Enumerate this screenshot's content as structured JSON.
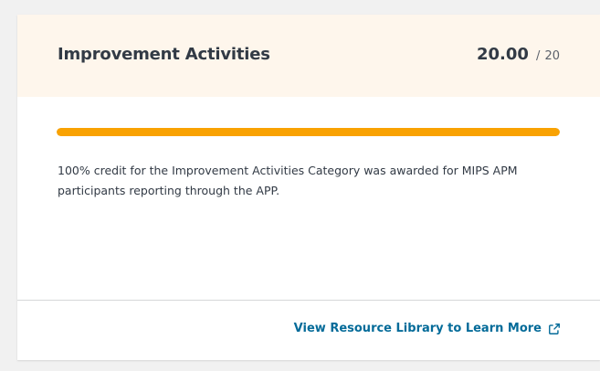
{
  "card": {
    "title": "Improvement Activities",
    "score": "20.00",
    "score_separator": "/",
    "score_max": "20",
    "progress_percent": 100,
    "description": "100% credit for the Improvement Activities Category was awarded for MIPS APM participants reporting through the APP.",
    "footer_link": "View Resource Library to Learn More",
    "footer_icon": "external-link-icon"
  },
  "colors": {
    "header_bg": "#fef6ec",
    "progress_fill": "#f9a202",
    "link": "#046b99",
    "text": "#323a45"
  }
}
